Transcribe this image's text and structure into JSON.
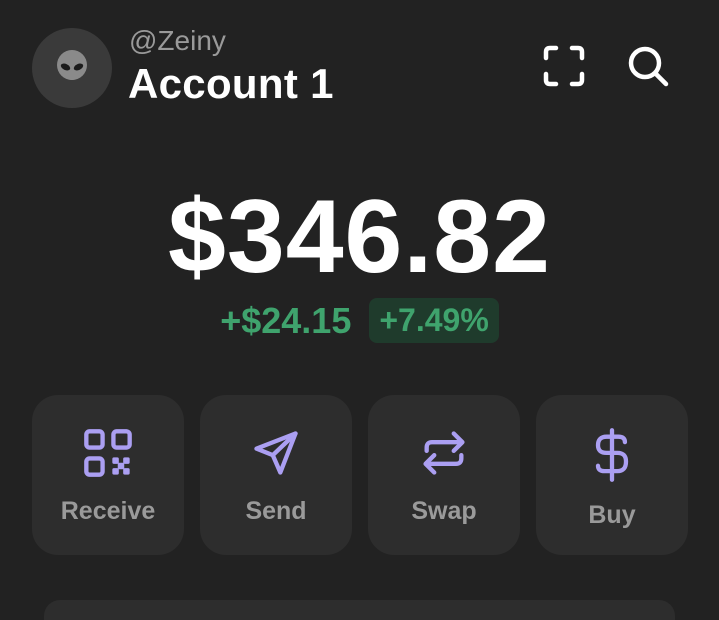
{
  "header": {
    "handle": "@Zeiny",
    "account_name": "Account 1",
    "avatar_icon": "alien-icon",
    "icons": [
      "scan-icon",
      "search-icon"
    ]
  },
  "balance": {
    "amount": "$346.82",
    "change_amount": "+$24.15",
    "change_percent": "+7.49%"
  },
  "actions": [
    {
      "label": "Receive",
      "icon": "qr-code-icon"
    },
    {
      "label": "Send",
      "icon": "send-arrow-icon"
    },
    {
      "label": "Swap",
      "icon": "swap-icon"
    },
    {
      "label": "Buy",
      "icon": "dollar-icon"
    }
  ],
  "colors": {
    "background": "#222222",
    "card": "#2d2d2d",
    "accent": "#ab9ff2",
    "positive": "#3fa36d"
  }
}
